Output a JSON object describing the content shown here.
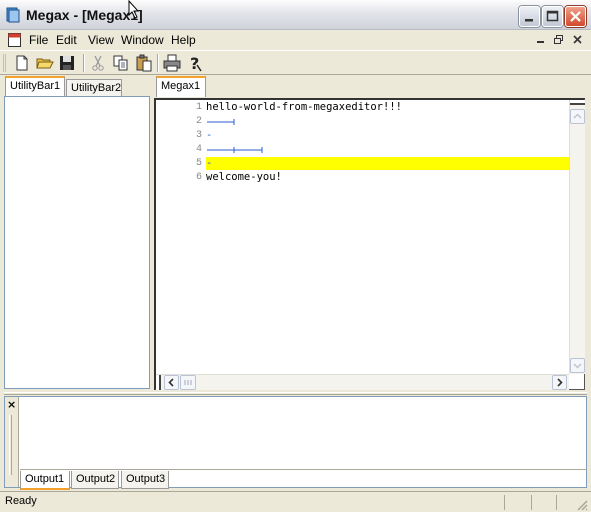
{
  "window": {
    "title": "Megax - [Megax1]"
  },
  "menu": {
    "items": [
      "File",
      "Edit",
      "View",
      "Window",
      "Help"
    ]
  },
  "toolbar": {
    "buttons": [
      "new-file-icon",
      "open-folder-icon",
      "save-icon",
      "cut-icon",
      "copy-icon",
      "paste-icon",
      "print-icon",
      "help-icon"
    ]
  },
  "left_panel": {
    "tabs": [
      "UtilityBar1",
      "UtilityBar2"
    ],
    "active_tab": "UtilityBar1"
  },
  "editor": {
    "tab": "Megax1",
    "lines": [
      {
        "number": "1",
        "text": "hello-world-from-megaxeditor!!!"
      },
      {
        "number": "2",
        "text": ""
      },
      {
        "number": "3",
        "text": "-"
      },
      {
        "number": "4",
        "text": ""
      },
      {
        "number": "5",
        "text": "-"
      },
      {
        "number": "6",
        "text": "welcome-you!"
      }
    ],
    "highlight_color": "#ffff00"
  },
  "output_panel": {
    "close_glyph": "×",
    "tabs": [
      "Output1",
      "Output2",
      "Output3"
    ],
    "active_tab": "Output1"
  },
  "status": {
    "text": "Ready"
  }
}
